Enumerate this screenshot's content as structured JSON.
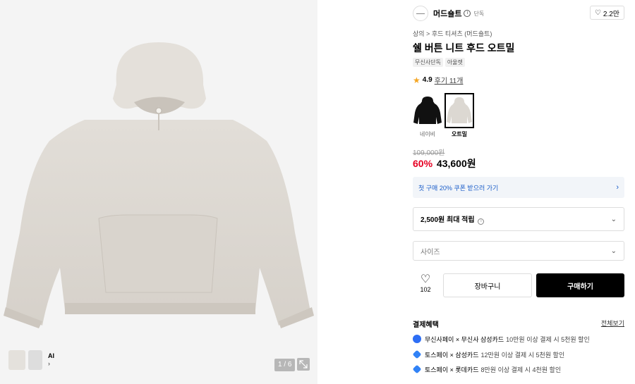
{
  "gallery": {
    "pager": "1 / 6",
    "ai_label": "AI",
    "ai_chevron": "›"
  },
  "brand": {
    "name": "머드숄트",
    "info_glyph": "i",
    "tag": "단독",
    "likes": "2.2만",
    "heart_glyph": "♡"
  },
  "breadcrumb": "상의 > 후드 티셔츠 (머드숄트)",
  "product": {
    "title": "쉘 버튼 니트 후드 오트밀",
    "badges": [
      "무신사단독",
      "아울렛"
    ]
  },
  "rating": {
    "star_glyph": "★",
    "score": "4.9",
    "reviews": "후기 11개"
  },
  "colors": [
    {
      "label": "네이비",
      "hex": "#111111"
    },
    {
      "label": "오트밀",
      "hex": "#dcd8d2",
      "selected": true
    }
  ],
  "price": {
    "original": "109,000원",
    "discount": "60%",
    "sale": "43,600원"
  },
  "coupon": {
    "text": "첫 구매 20% 쿠폰 받으러 가기",
    "chevron": "›"
  },
  "points": {
    "text": "2,500원 최대 적립",
    "info_glyph": "i",
    "chevron": "⌄"
  },
  "size": {
    "placeholder": "사이즈",
    "chevron": "⌄"
  },
  "actions": {
    "wish_glyph": "♡",
    "wish_count": "102",
    "cart": "장바구니",
    "buy": "구매하기"
  },
  "payment": {
    "title": "결제혜택",
    "more": "전체보기",
    "items": [
      {
        "name": "무신사페이 × 무신사 삼성카드",
        "desc": "10만원 이상 결제 시 5천원 할인",
        "icon": "musinsa-pay-icon",
        "color": "#2d6ef5"
      },
      {
        "name": "토스페이 × 삼성카드",
        "desc": "12만원 이상 결제 시 5천원 할인",
        "icon": "toss-pay-icon",
        "color": "#3182f6"
      },
      {
        "name": "토스페이 × 롯데카드",
        "desc": "8만원 이상 결제 시 4천원 할인",
        "icon": "toss-pay-icon",
        "color": "#3182f6"
      }
    ]
  }
}
